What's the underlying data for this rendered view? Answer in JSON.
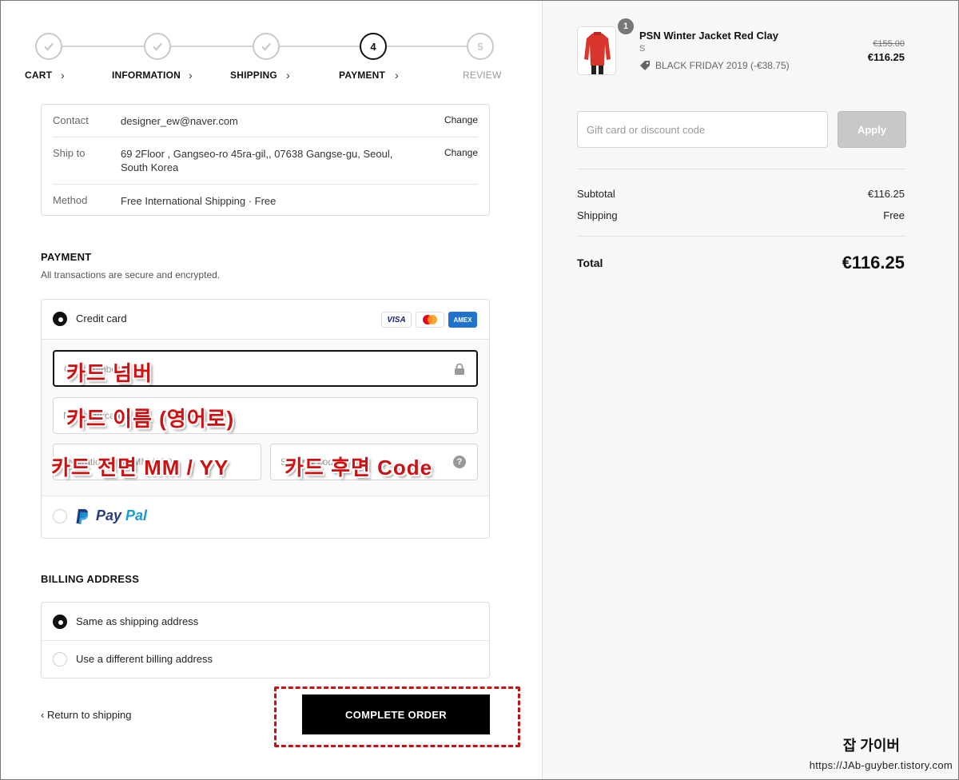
{
  "steps": [
    {
      "label": "CART",
      "state": "done"
    },
    {
      "label": "INFORMATION",
      "state": "done"
    },
    {
      "label": "SHIPPING",
      "state": "done"
    },
    {
      "label": "PAYMENT",
      "state": "current",
      "number": "4"
    },
    {
      "label": "REVIEW",
      "state": "upcoming",
      "number": "5"
    }
  ],
  "summary": {
    "contact_label": "Contact",
    "contact_value": "designer_ew@naver.com",
    "shipto_label": "Ship to",
    "shipto_value": "69 2Floor , Gangseo-ro 45ra-gil,, 07638 Gangse-gu, Seoul, South Korea",
    "method_label": "Method",
    "method_value": "Free International Shipping · Free",
    "change_label": "Change"
  },
  "payment": {
    "title": "PAYMENT",
    "subtitle": "All transactions are secure and encrypted.",
    "credit_card_label": "Credit card",
    "card_brands": [
      "VISA",
      "MC",
      "AMEX"
    ],
    "card_number_placeholder": "Card number",
    "name_placeholder": "Name on card",
    "expiry_placeholder": "Expiration date (MM / YY)",
    "security_placeholder": "Security code",
    "overlay_card_number": "카드 넘버",
    "overlay_name": "카드 이름 (영어로)",
    "overlay_expiry": "카드 전면 MM / YY",
    "overlay_security": "카드 후면 Code",
    "paypal_pay": "Pay",
    "paypal_pal": "Pal"
  },
  "billing": {
    "title": "BILLING ADDRESS",
    "same_label": "Same as shipping address",
    "different_label": "Use a different billing address"
  },
  "footer": {
    "return_label": "Return to shipping",
    "complete_label": "COMPLETE ORDER"
  },
  "order": {
    "quantity": "1",
    "product_name": "PSN Winter Jacket Red Clay",
    "size": "S",
    "promo": "BLACK FRIDAY 2019 (-€38.75)",
    "old_price": "€155.00",
    "new_price": "€116.25",
    "discount_placeholder": "Gift card or discount code",
    "apply_label": "Apply",
    "subtotal_label": "Subtotal",
    "subtotal_value": "€116.25",
    "shipping_label": "Shipping",
    "shipping_value": "Free",
    "total_label": "Total",
    "total_value": "€116.25"
  },
  "watermark": {
    "name": "잡 가이버",
    "url": "https://JAb-guyber.tistory.com"
  },
  "colors": {
    "accent": "#111111",
    "annotation_red": "#d01010",
    "paypal_dark": "#253b80",
    "paypal_light": "#179bd7",
    "jacket_red": "#d8362c"
  }
}
